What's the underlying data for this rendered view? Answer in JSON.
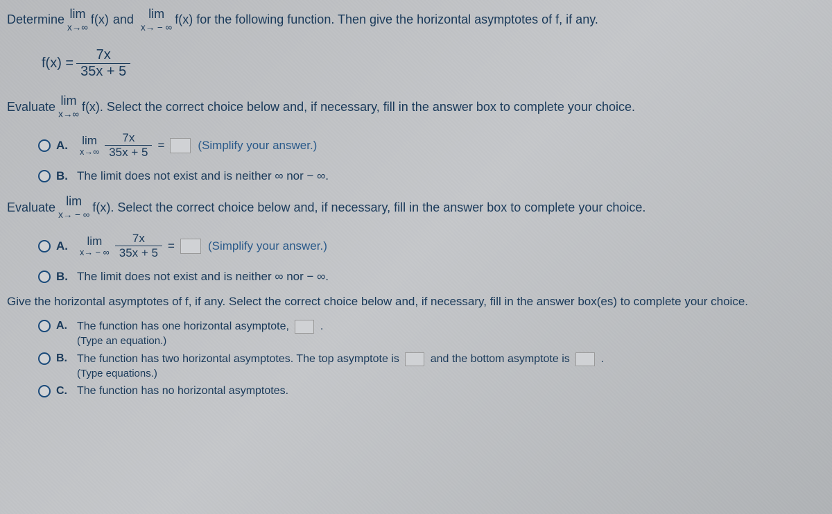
{
  "intro": {
    "part1": "Determine",
    "lim1_top": "lim",
    "lim1_bottom": "x→∞",
    "func": "f(x)",
    "and": "and",
    "lim2_top": "lim",
    "lim2_bottom": "x→ − ∞",
    "part2": "f(x) for the following function. Then give the horizontal asymptotes of f, if any."
  },
  "function": {
    "lhs": "f(x) =",
    "num": "7x",
    "den": "35x + 5"
  },
  "eval1": {
    "text1": "Evaluate",
    "lim_top": "lim",
    "lim_bottom": "x→∞",
    "text2": "f(x). Select the correct choice below and, if necessary, fill in the answer box to complete your choice."
  },
  "choice1": {
    "a_label": "A.",
    "a_lim_top": "lim",
    "a_lim_bottom": "x→∞",
    "a_num": "7x",
    "a_den": "35x + 5",
    "a_equals": "=",
    "a_hint": "(Simplify your answer.)",
    "b_label": "B.",
    "b_text": "The limit does not exist and is neither ∞ nor − ∞."
  },
  "eval2": {
    "text1": "Evaluate",
    "lim_top": "lim",
    "lim_bottom": "x→ − ∞",
    "text2": "f(x). Select the correct choice below and, if necessary, fill in the answer box to complete your choice."
  },
  "choice2": {
    "a_label": "A.",
    "a_lim_top": "lim",
    "a_lim_bottom": "x→ − ∞",
    "a_num": "7x",
    "a_den": "35x + 5",
    "a_equals": "=",
    "a_hint": "(Simplify your answer.)",
    "b_label": "B.",
    "b_text": "The limit does not exist and is neither ∞ nor − ∞."
  },
  "asymptote": {
    "question": "Give the horizontal asymptotes of f, if any. Select the correct choice below and, if necessary, fill in the answer box(es) to complete your choice.",
    "a_label": "A.",
    "a_text": "The function has one horizontal asymptote,",
    "a_sub": "(Type an equation.)",
    "b_label": "B.",
    "b_text1": "The function has two horizontal asymptotes. The top asymptote is",
    "b_text2": "and the bottom asymptote is",
    "b_sub": "(Type equations.)",
    "c_label": "C.",
    "c_text": "The function has no horizontal asymptotes."
  }
}
